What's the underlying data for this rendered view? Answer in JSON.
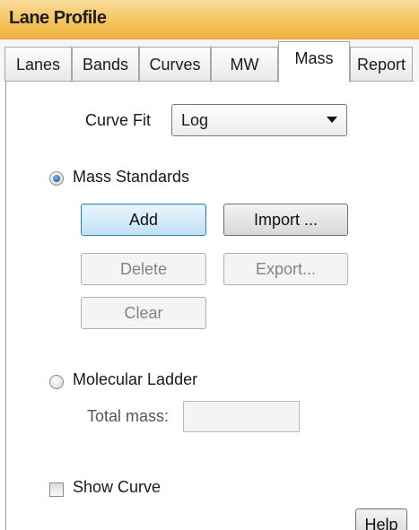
{
  "panel": {
    "title": "Lane Profile"
  },
  "tabs": [
    {
      "label": "Lanes"
    },
    {
      "label": "Bands"
    },
    {
      "label": "Curves"
    },
    {
      "label": "MW"
    },
    {
      "label": "Mass",
      "active": true
    },
    {
      "label": "Report"
    }
  ],
  "curve_fit": {
    "label": "Curve Fit",
    "selected": "Log"
  },
  "mass_standards": {
    "label": "Mass Standards",
    "selected": true,
    "add_label": "Add",
    "import_label": "Import ...",
    "delete_label": "Delete",
    "export_label": "Export...",
    "clear_label": "Clear"
  },
  "molecular_ladder": {
    "label": "Molecular Ladder",
    "selected": false,
    "total_mass_label": "Total mass:",
    "total_mass_value": ""
  },
  "show_curve": {
    "label": "Show Curve",
    "checked": false
  },
  "help_label": "Help",
  "colors": {
    "title_bar": "#f4c45e",
    "primary_button": "#d6ecf9",
    "radio_selected": "#1c5fa8"
  }
}
